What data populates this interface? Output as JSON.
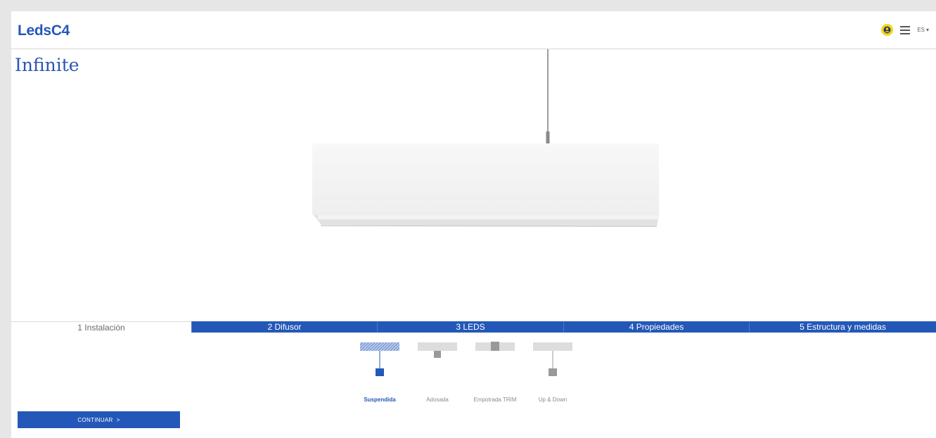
{
  "header": {
    "logo": "LedsC4",
    "language": "ES"
  },
  "product": {
    "title": "Infinite"
  },
  "tabs": [
    {
      "label": "1 Instalación"
    },
    {
      "label": "2 Difusor"
    },
    {
      "label": "3 LEDS"
    },
    {
      "label": "4 Propiedades"
    },
    {
      "label": "5 Estructura y medidas"
    }
  ],
  "installation_options": [
    {
      "label": "Suspendida",
      "selected": true
    },
    {
      "label": "Adosada",
      "selected": false
    },
    {
      "label": "Empotrada TRIM",
      "selected": false
    },
    {
      "label": "Up & Down",
      "selected": false
    }
  ],
  "actions": {
    "continue_label": "CONTINUAR",
    "continue_arrow": ">"
  },
  "colors": {
    "brand_blue": "#2458b8",
    "user_icon_yellow": "#f4d71c"
  }
}
